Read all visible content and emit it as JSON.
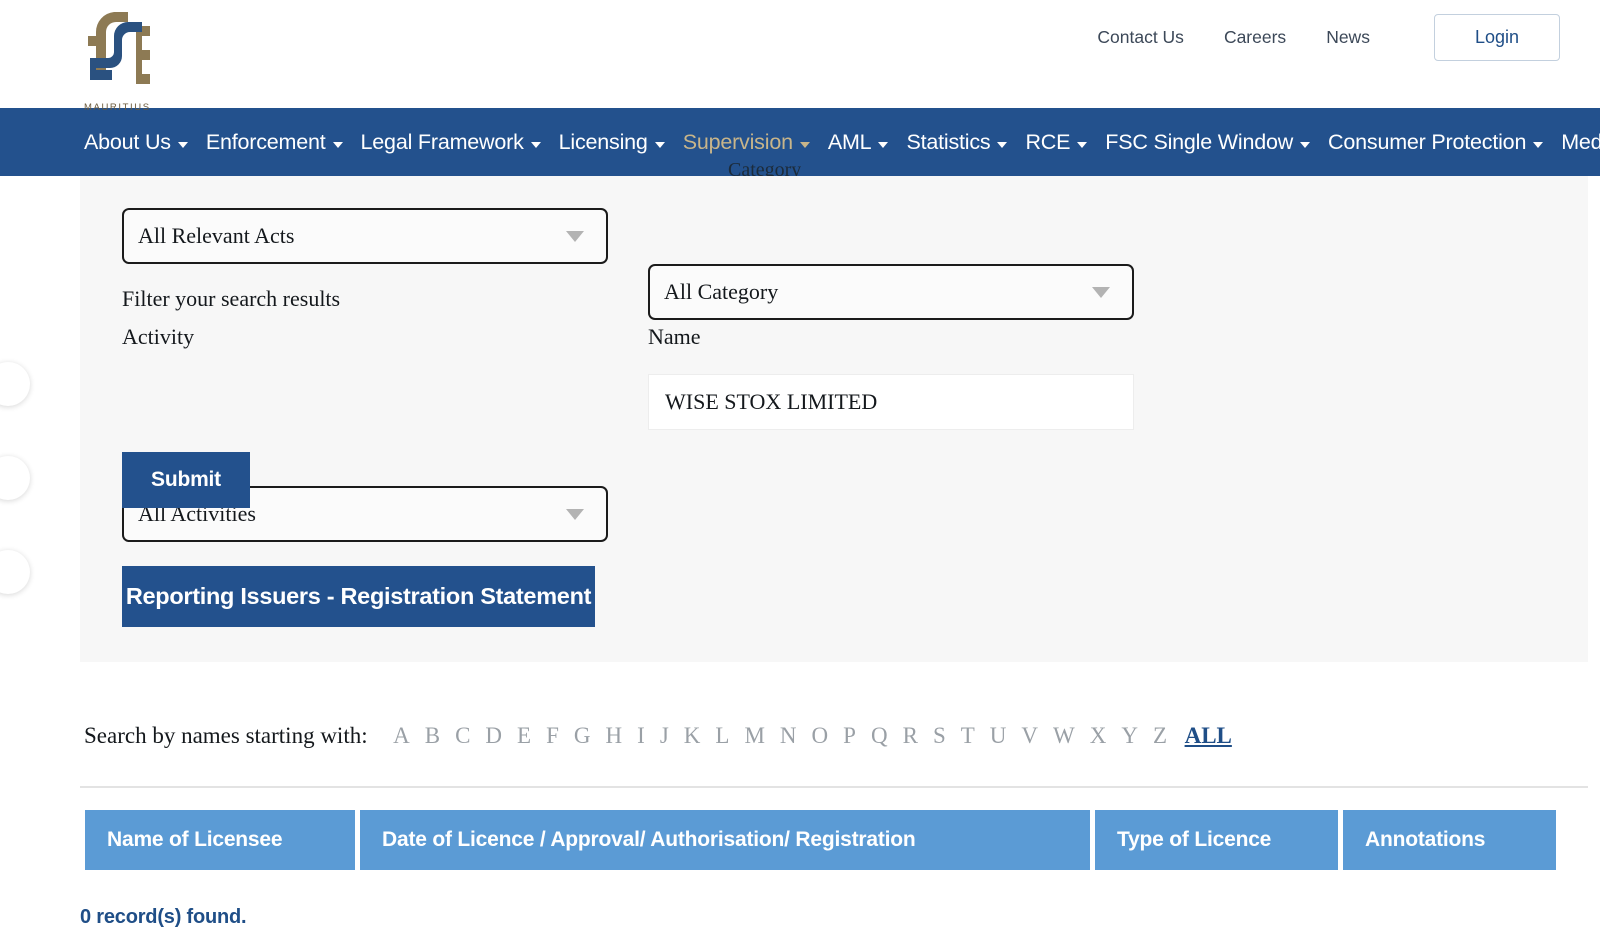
{
  "header": {
    "logo_alt": "FSC Mauritius",
    "logo_caption": "MAURITIUS",
    "links": [
      {
        "label": "Contact Us",
        "name": "contact-us"
      },
      {
        "label": "Careers",
        "name": "careers"
      },
      {
        "label": "News",
        "name": "news"
      }
    ],
    "login_label": "Login"
  },
  "nav": {
    "items": [
      {
        "label": "About Us",
        "has_caret": true,
        "active": false
      },
      {
        "label": "Enforcement",
        "has_caret": true,
        "active": false
      },
      {
        "label": "Legal Framework",
        "has_caret": true,
        "active": false
      },
      {
        "label": "Licensing",
        "has_caret": true,
        "active": false
      },
      {
        "label": "Supervision",
        "has_caret": true,
        "active": true
      },
      {
        "label": "AML",
        "has_caret": true,
        "active": false
      },
      {
        "label": "Statistics",
        "has_caret": true,
        "active": false
      },
      {
        "label": "RCE",
        "has_caret": true,
        "active": false
      },
      {
        "label": "FSC Single Window",
        "has_caret": true,
        "active": false
      },
      {
        "label": "Consumer Protection",
        "has_caret": true,
        "active": false
      },
      {
        "label": "Media Corner",
        "has_caret": true,
        "active": false
      }
    ]
  },
  "search_panel": {
    "cut_off_label": "Category",
    "relevant_acts": {
      "label": "Relevant Acts",
      "selected": "All Relevant Acts"
    },
    "category": {
      "label": "Category",
      "selected": "All Category"
    },
    "filter_note": "Filter your search results",
    "activity": {
      "label": "Activity",
      "selected": "All Activities"
    },
    "name": {
      "label": "Name",
      "value": "WISE STOX LIMITED",
      "placeholder": "Name"
    },
    "submit_label": "Submit",
    "reporting_label": "Reporting Issuers - Registration Statement"
  },
  "alphabet": {
    "lead_text": "Search by names starting with:",
    "letters": [
      "A",
      "B",
      "C",
      "D",
      "E",
      "F",
      "G",
      "H",
      "I",
      "J",
      "K",
      "L",
      "M",
      "N",
      "O",
      "P",
      "Q",
      "R",
      "S",
      "T",
      "U",
      "V",
      "W",
      "X",
      "Y",
      "Z"
    ],
    "all_label": "ALL"
  },
  "results": {
    "columns": [
      "Name of Licensee",
      "Date of Licence / Approval/ Authorisation/ Registration",
      "Type of Licence",
      "Annotations"
    ],
    "rows": [],
    "record_count_text": "0 record(s) found."
  },
  "colors": {
    "nav_blue": "#23518d",
    "accent_gold": "#c8b58a",
    "table_header_blue": "#5b9bd5",
    "panel_bg": "#f7f7f7",
    "link_blue": "#1f4e87"
  }
}
